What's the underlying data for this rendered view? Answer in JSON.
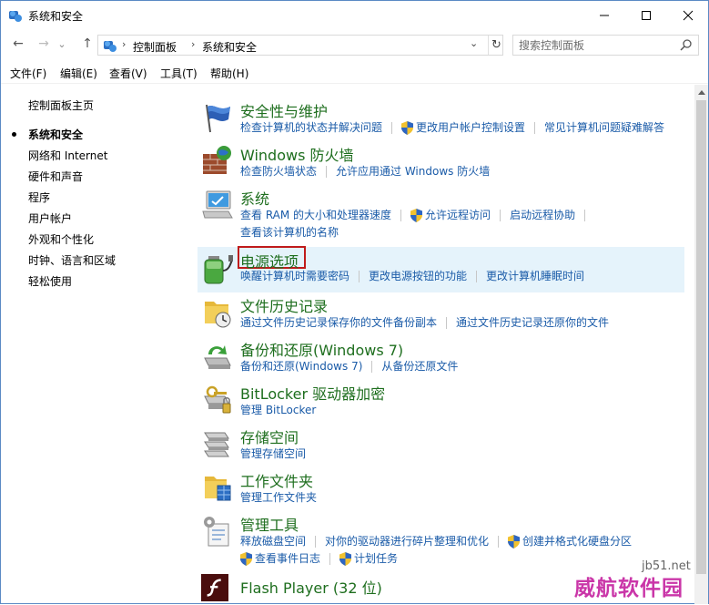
{
  "window": {
    "title": "系统和安全"
  },
  "nav": {
    "back_label": "←",
    "forward_label": "→",
    "recent_label": "⌄",
    "up_label": "↑",
    "breadcrumb": [
      "控制面板",
      "系统和安全"
    ],
    "search_placeholder": "搜索控制面板"
  },
  "menu": [
    "文件(F)",
    "编辑(E)",
    "查看(V)",
    "工具(T)",
    "帮助(H)"
  ],
  "sidebar": {
    "items": [
      {
        "label": "控制面板主页"
      },
      {
        "label": "系统和安全",
        "active": true
      },
      {
        "label": "网络和 Internet"
      },
      {
        "label": "硬件和声音"
      },
      {
        "label": "程序"
      },
      {
        "label": "用户帐户"
      },
      {
        "label": "外观和个性化"
      },
      {
        "label": "时钟、语言和区域"
      },
      {
        "label": "轻松使用"
      }
    ]
  },
  "categories": [
    {
      "title": "安全性与维护",
      "icon": "flag-icon",
      "links": [
        {
          "label": "检查计算机的状态并解决问题"
        },
        {
          "label": "更改用户帐户控制设置",
          "shield": true
        },
        {
          "label": "常见计算机问题疑难解答"
        }
      ]
    },
    {
      "title": "Windows 防火墙",
      "icon": "firewall-icon",
      "links": [
        {
          "label": "检查防火墙状态"
        },
        {
          "label": "允许应用通过 Windows 防火墙"
        }
      ]
    },
    {
      "title": "系统",
      "icon": "computer-icon",
      "links": [
        {
          "label": "查看 RAM 的大小和处理器速度"
        },
        {
          "label": "允许远程访问",
          "shield": true
        },
        {
          "label": "启动远程协助"
        }
      ],
      "links2": [
        {
          "label": "查看该计算机的名称"
        }
      ]
    },
    {
      "title": "电源选项",
      "icon": "battery-icon",
      "highlight": true,
      "links": [
        {
          "label": "唤醒计算机时需要密码"
        },
        {
          "label": "更改电源按钮的功能"
        },
        {
          "label": "更改计算机睡眠时间"
        }
      ]
    },
    {
      "title": "文件历史记录",
      "icon": "folder-history-icon",
      "links": [
        {
          "label": "通过文件历史记录保存你的文件备份副本"
        },
        {
          "label": "通过文件历史记录还原你的文件"
        }
      ]
    },
    {
      "title": "备份和还原(Windows 7)",
      "icon": "backup-icon",
      "links": [
        {
          "label": "备份和还原(Windows 7)"
        },
        {
          "label": "从备份还原文件"
        }
      ]
    },
    {
      "title": "BitLocker 驱动器加密",
      "icon": "bitlocker-icon",
      "links": [
        {
          "label": "管理 BitLocker"
        }
      ]
    },
    {
      "title": "存储空间",
      "icon": "storage-icon",
      "links": [
        {
          "label": "管理存储空间"
        }
      ]
    },
    {
      "title": "工作文件夹",
      "icon": "work-folder-icon",
      "links": [
        {
          "label": "管理工作文件夹"
        }
      ]
    },
    {
      "title": "管理工具",
      "icon": "admin-tools-icon",
      "links": [
        {
          "label": "释放磁盘空间"
        },
        {
          "label": "对你的驱动器进行碎片整理和优化"
        },
        {
          "label": "创建并格式化硬盘分区",
          "shield": true
        }
      ],
      "links2": [
        {
          "label": "查看事件日志",
          "shield": true
        },
        {
          "label": "计划任务",
          "shield": true
        }
      ]
    },
    {
      "title": "Flash Player (32 位)",
      "icon": "flash-icon",
      "links": []
    }
  ],
  "watermark": {
    "site": "jb51.net",
    "text": "威航软件园"
  },
  "colors": {
    "title_green": "#1e6e1e",
    "link_blue": "#1a5ba8",
    "highlight_bg": "#e5f3fb",
    "red_box": "#c01b1b"
  }
}
